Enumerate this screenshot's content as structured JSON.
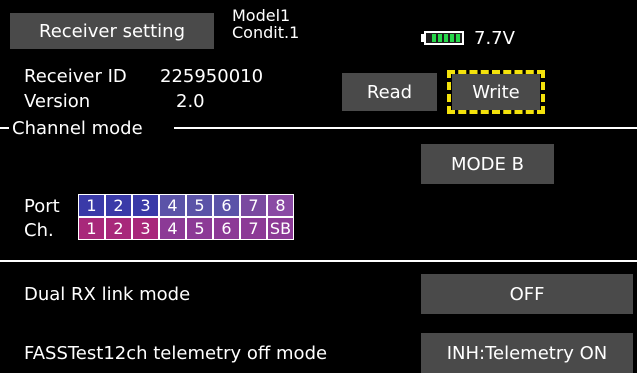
{
  "header": {
    "title": "Receiver setting",
    "model": "Model1",
    "condition": "Condit.1",
    "voltage": "7.7V",
    "battery_level": 1.0,
    "battery_color": "#27d64a"
  },
  "receiver": {
    "id_label": "Receiver ID",
    "id_value": "225950010",
    "version_label": "Version",
    "version_value": "2.0"
  },
  "buttons": {
    "read": "Read",
    "write": "Write",
    "write_highlight_color": "#f4e20c"
  },
  "channel_mode": {
    "legend": "Channel mode",
    "mode_button": "MODE B",
    "port_label": "Port",
    "ch_label": "Ch.",
    "ports": [
      "1",
      "2",
      "3",
      "4",
      "5",
      "6",
      "7",
      "8"
    ],
    "channels": [
      "1",
      "2",
      "3",
      "4",
      "5",
      "6",
      "7",
      "SB"
    ]
  },
  "dual_rx": {
    "label": "Dual RX link mode",
    "value": "OFF"
  },
  "telemetry": {
    "label": "FASSTest12ch telemetry off mode",
    "value": "INH:Telemetry ON"
  }
}
